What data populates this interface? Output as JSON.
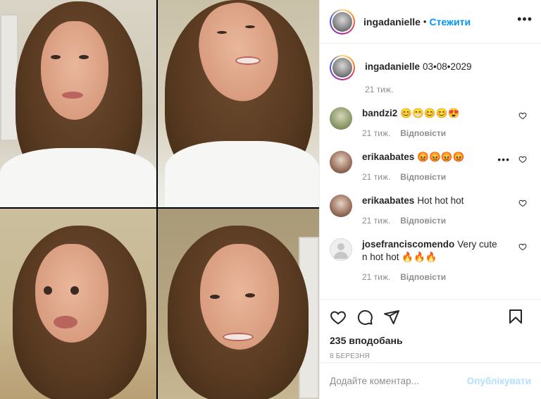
{
  "header": {
    "username": "ingadanielle",
    "separator": "•",
    "follow_label": "Стежити",
    "more_icon": "more-horizontal-icon"
  },
  "caption": {
    "username": "ingadanielle",
    "text": "03•08•2029",
    "age": "21 тиж."
  },
  "comments": [
    {
      "username": "bandzi2",
      "text": "😊😁😊😊😍",
      "age": "21 тиж.",
      "reply_label": "Відповісти"
    },
    {
      "username": "erikaabates",
      "text": "😡😡😡😡",
      "age": "21 тиж.",
      "reply_label": "Відповісти"
    },
    {
      "username": "erikaabates",
      "text": "Hot hot hot",
      "age": "21 тиж.",
      "reply_label": "Відповісти"
    },
    {
      "username": "josefranciscomendo",
      "text": "Very cute n hot hot 🔥🔥🔥",
      "age": "21 тиж.",
      "reply_label": "Відповісти"
    }
  ],
  "actions": {
    "likes": "235 вподобань",
    "date": "8 БЕРЕЗНЯ"
  },
  "add_comment": {
    "placeholder": "Додайте коментар...",
    "publish_label": "Опублікувати"
  },
  "colors": {
    "accent": "#0095f6",
    "publish_disabled": "#b2dffc",
    "muted": "#8e8e8e",
    "text": "#262626"
  }
}
